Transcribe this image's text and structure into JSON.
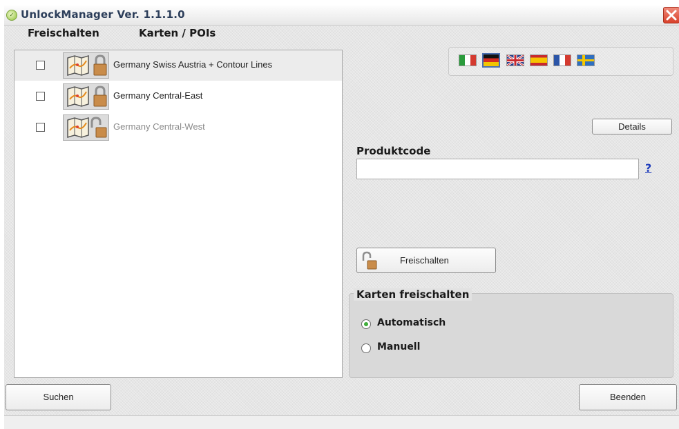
{
  "window": {
    "title": "UnlockManager Ver. 1.1.1.0"
  },
  "list": {
    "headers": {
      "unlock": "Freischalten",
      "maps": "Karten / POIs"
    },
    "rows": [
      {
        "label": "Germany Swiss Austria + Contour Lines",
        "checked": false,
        "locked": true,
        "selected": true
      },
      {
        "label": "Germany Central-East",
        "checked": false,
        "locked": true,
        "selected": false
      },
      {
        "label": "Germany Central-West",
        "checked": false,
        "locked": false,
        "selected": false
      }
    ]
  },
  "languages": [
    "italian-flag",
    "german-flag",
    "uk-flag",
    "spanish-flag",
    "french-flag",
    "swedish-flag"
  ],
  "details_button": "Details",
  "product_code": {
    "label": "Produktcode",
    "value": "",
    "help": "?"
  },
  "unlock_button": "Freischalten",
  "unlock_mode": {
    "legend": "Karten freischalten",
    "options": [
      {
        "label": "Automatisch",
        "selected": true
      },
      {
        "label": "Manuell",
        "selected": false
      }
    ]
  },
  "footer": {
    "search_button": "Suchen",
    "exit_button": "Beenden"
  },
  "colors": {
    "radio_selected": "#3fae3a",
    "close_button": "#d8402a",
    "help_link": "#1f3dbb"
  }
}
